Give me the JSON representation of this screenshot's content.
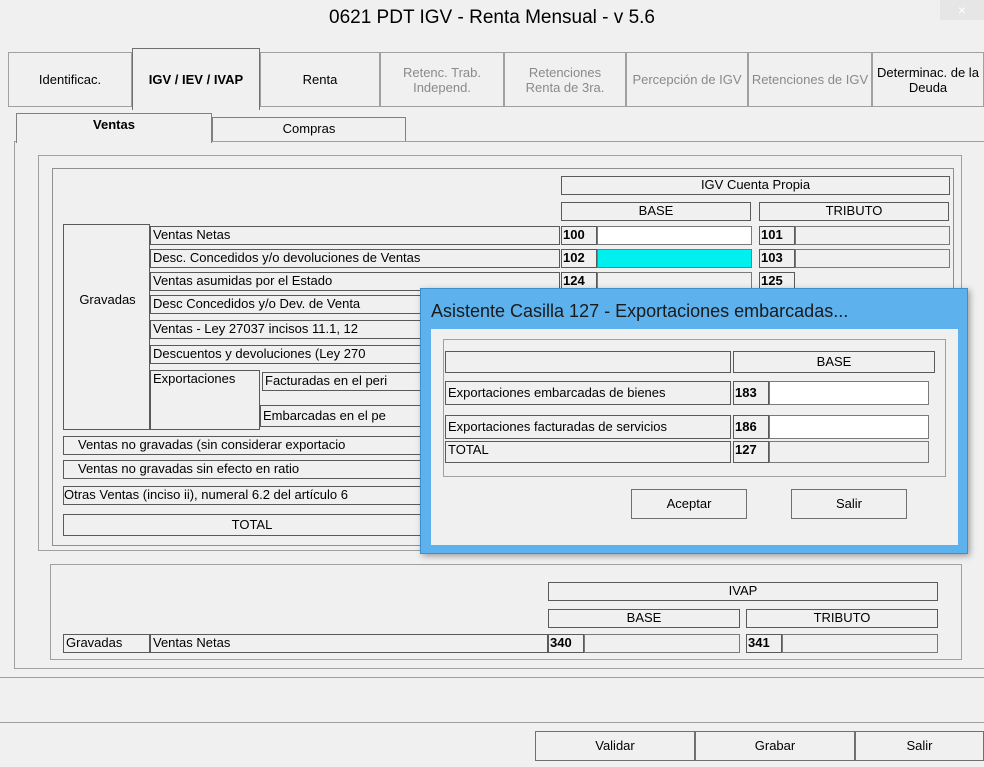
{
  "window": {
    "title": "0621 PDT IGV - Renta Mensual - v 5.6",
    "close_glyph": "×"
  },
  "tabs": [
    {
      "label": "Identificac.",
      "state": "normal"
    },
    {
      "label": "IGV / IEV / IVAP",
      "state": "active"
    },
    {
      "label": "Renta",
      "state": "normal"
    },
    {
      "label": "Retenc. Trab. Independ.",
      "state": "disabled"
    },
    {
      "label": "Retenciones Renta de 3ra.",
      "state": "disabled"
    },
    {
      "label": "Percepción de IGV",
      "state": "disabled"
    },
    {
      "label": "Retenciones de IGV",
      "state": "disabled"
    },
    {
      "label": "Determinac. de la Deuda",
      "state": "normal"
    }
  ],
  "subtabs": [
    "Ventas",
    "Compras"
  ],
  "igv": {
    "header": "IGV Cuenta Propia",
    "base": "BASE",
    "tributo": "TRIBUTO",
    "gravadas": "Gravadas",
    "rows": [
      {
        "label": "Ventas Netas",
        "code_base": "100",
        "code_tributo": "101"
      },
      {
        "label": "Desc. Concedidos  y/o devoluciones de Ventas",
        "code_base": "102",
        "code_tributo": "103"
      },
      {
        "label": "Ventas asumidas por el Estado",
        "code_base": "124",
        "code_tributo": "125"
      },
      {
        "label": "Desc Concedidos y/o Dev. de Venta"
      },
      {
        "label": "Ventas - Ley 27037  incisos 11.1, 12"
      },
      {
        "label": "Descuentos y devoluciones (Ley 270"
      }
    ],
    "exportaciones": "Exportaciones",
    "facturadas": "Facturadas en el peri",
    "embarcadas": "Embarcadas en el pe",
    "no_gravadas": "Ventas  no gravadas (sin considerar exportacio",
    "no_gravadas_ratio": "Ventas  no gravadas sin efecto en ratio",
    "otras": "Otras Ventas (inciso ii), numeral 6.2 del artículo 6",
    "total": "TOTAL"
  },
  "ivap": {
    "header": "IVAP",
    "base": "BASE",
    "tributo": "TRIBUTO",
    "gravadas": "Gravadas",
    "ventas_netas": "Ventas Netas",
    "code_base": "340",
    "code_tributo": "341"
  },
  "footer_buttons": {
    "validar": "Validar",
    "grabar": "Grabar",
    "salir": "Salir"
  },
  "dialog": {
    "title": "Asistente Casilla 127 - Exportaciones embarcadas...",
    "base": "BASE",
    "rows": [
      {
        "label": "Exportaciones embarcadas de bienes",
        "code": "183",
        "value": ""
      },
      {
        "label": "Exportaciones facturadas de servicios",
        "code": "186",
        "value": ""
      },
      {
        "label": "TOTAL",
        "code": "127",
        "value": ""
      }
    ],
    "aceptar": "Aceptar",
    "salir": "Salir"
  },
  "colors": {
    "dialog_frame": "#5db2ee",
    "highlight_field": "#00f0f0"
  }
}
